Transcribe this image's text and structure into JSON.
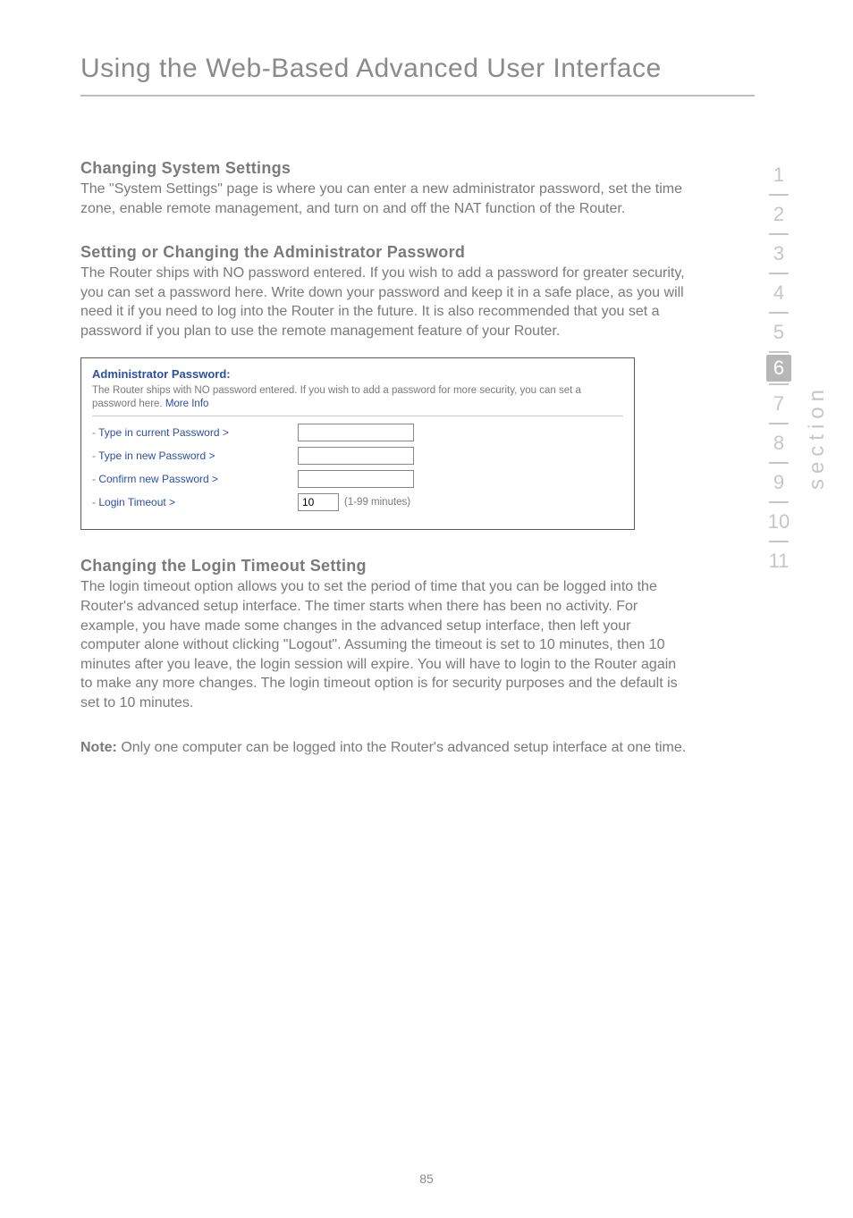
{
  "chapter": {
    "title": "Using the Web-Based Advanced User Interface"
  },
  "sections": {
    "s1": {
      "heading": "Changing System Settings",
      "body": "The \"System Settings\" page is where you can enter a new administrator password, set the time zone, enable remote management, and turn on and off the NAT function of the Router."
    },
    "s2": {
      "heading": "Setting or Changing the Administrator Password",
      "body": "The Router ships with NO password entered. If you wish to add a password for greater security, you can set a password here. Write down your password and keep it in a safe place, as you will need it if you need to log into the Router in the future. It is also recommended that you set a password if you plan to use the remote management feature of your Router."
    },
    "s3": {
      "heading": "Changing the Login Timeout Setting",
      "body": "The login timeout option allows you to set the period of time that you can be logged into the Router's advanced setup interface. The timer starts when there has been no activity. For example, you have made some changes in the advanced setup interface, then left your computer alone without clicking \"Logout\". Assuming the timeout is set to 10 minutes, then 10 minutes after you leave, the login session will expire. You will have to login to the Router again to make any more changes. The login timeout option is for security purposes and the default is set to 10 minutes."
    },
    "note": {
      "label": "Note:",
      "text": " Only one computer can be logged into the Router's advanced setup interface at one time."
    }
  },
  "panel": {
    "title": "Administrator Password:",
    "desc_a": "The Router ships with NO password entered. If you wish to add a password for more security, you can set a password here. ",
    "desc_link": "More Info",
    "rows": {
      "r1": {
        "label": "Type in current Password >"
      },
      "r2": {
        "label": "Type in new Password >"
      },
      "r3": {
        "label": "Confirm new Password >"
      },
      "r4": {
        "label": "Login Timeout >",
        "value": "10",
        "units": "(1-99 minutes)"
      }
    }
  },
  "sidenav": {
    "items": [
      "1",
      "2",
      "3",
      "4",
      "5",
      "6",
      "7",
      "8",
      "9",
      "10",
      "11"
    ],
    "active_index": 5,
    "section_label": "section"
  },
  "page_number": "85"
}
